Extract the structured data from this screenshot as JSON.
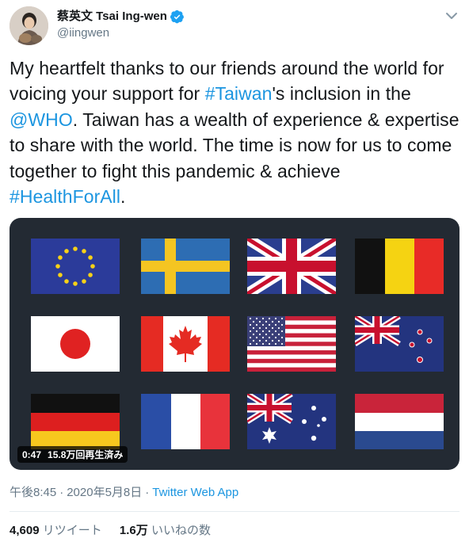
{
  "tweet": {
    "author": {
      "display_name": "蔡英文 Tsai Ing-wen",
      "handle": "@iingwen",
      "verified_icon": "verified-badge-icon"
    },
    "text": [
      {
        "t": "My heartfelt thanks to our friends around the world for voicing your support for ",
        "link": false
      },
      {
        "t": "#Taiwan",
        "link": true
      },
      {
        "t": "'s inclusion in the ",
        "link": false
      },
      {
        "t": "@WHO",
        "link": true
      },
      {
        "t": ". Taiwan has a wealth of experience & expertise to share with the world. The time is now for us to come together to fight this pandemic & achieve ",
        "link": false
      },
      {
        "t": "#HealthForAll",
        "link": true
      },
      {
        "t": ".",
        "link": false
      }
    ],
    "video": {
      "duration": "0:47",
      "views": "15.8万回再生済み"
    },
    "meta": {
      "time": "午後8:45",
      "separator": "·",
      "date": "2020年5月8日",
      "source": "Twitter Web App"
    },
    "stats": {
      "retweets_count": "4,609",
      "retweets_label": "リツイート",
      "likes_count": "1.6万",
      "likes_label": "いいねの数"
    },
    "colors": {
      "link": "#1b95e0",
      "muted": "#657786",
      "media_bg": "#232a33",
      "verified": "#1da1f2"
    }
  }
}
